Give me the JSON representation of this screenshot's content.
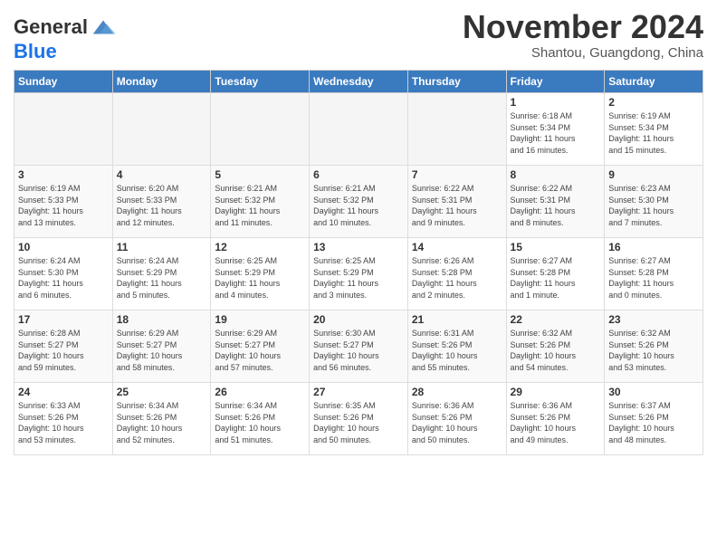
{
  "header": {
    "logo_line1": "General",
    "logo_line2": "Blue",
    "month_title": "November 2024",
    "subtitle": "Shantou, Guangdong, China"
  },
  "weekdays": [
    "Sunday",
    "Monday",
    "Tuesday",
    "Wednesday",
    "Thursday",
    "Friday",
    "Saturday"
  ],
  "weeks": [
    [
      {
        "day": "",
        "info": ""
      },
      {
        "day": "",
        "info": ""
      },
      {
        "day": "",
        "info": ""
      },
      {
        "day": "",
        "info": ""
      },
      {
        "day": "",
        "info": ""
      },
      {
        "day": "1",
        "info": "Sunrise: 6:18 AM\nSunset: 5:34 PM\nDaylight: 11 hours\nand 16 minutes."
      },
      {
        "day": "2",
        "info": "Sunrise: 6:19 AM\nSunset: 5:34 PM\nDaylight: 11 hours\nand 15 minutes."
      }
    ],
    [
      {
        "day": "3",
        "info": "Sunrise: 6:19 AM\nSunset: 5:33 PM\nDaylight: 11 hours\nand 13 minutes."
      },
      {
        "day": "4",
        "info": "Sunrise: 6:20 AM\nSunset: 5:33 PM\nDaylight: 11 hours\nand 12 minutes."
      },
      {
        "day": "5",
        "info": "Sunrise: 6:21 AM\nSunset: 5:32 PM\nDaylight: 11 hours\nand 11 minutes."
      },
      {
        "day": "6",
        "info": "Sunrise: 6:21 AM\nSunset: 5:32 PM\nDaylight: 11 hours\nand 10 minutes."
      },
      {
        "day": "7",
        "info": "Sunrise: 6:22 AM\nSunset: 5:31 PM\nDaylight: 11 hours\nand 9 minutes."
      },
      {
        "day": "8",
        "info": "Sunrise: 6:22 AM\nSunset: 5:31 PM\nDaylight: 11 hours\nand 8 minutes."
      },
      {
        "day": "9",
        "info": "Sunrise: 6:23 AM\nSunset: 5:30 PM\nDaylight: 11 hours\nand 7 minutes."
      }
    ],
    [
      {
        "day": "10",
        "info": "Sunrise: 6:24 AM\nSunset: 5:30 PM\nDaylight: 11 hours\nand 6 minutes."
      },
      {
        "day": "11",
        "info": "Sunrise: 6:24 AM\nSunset: 5:29 PM\nDaylight: 11 hours\nand 5 minutes."
      },
      {
        "day": "12",
        "info": "Sunrise: 6:25 AM\nSunset: 5:29 PM\nDaylight: 11 hours\nand 4 minutes."
      },
      {
        "day": "13",
        "info": "Sunrise: 6:25 AM\nSunset: 5:29 PM\nDaylight: 11 hours\nand 3 minutes."
      },
      {
        "day": "14",
        "info": "Sunrise: 6:26 AM\nSunset: 5:28 PM\nDaylight: 11 hours\nand 2 minutes."
      },
      {
        "day": "15",
        "info": "Sunrise: 6:27 AM\nSunset: 5:28 PM\nDaylight: 11 hours\nand 1 minute."
      },
      {
        "day": "16",
        "info": "Sunrise: 6:27 AM\nSunset: 5:28 PM\nDaylight: 11 hours\nand 0 minutes."
      }
    ],
    [
      {
        "day": "17",
        "info": "Sunrise: 6:28 AM\nSunset: 5:27 PM\nDaylight: 10 hours\nand 59 minutes."
      },
      {
        "day": "18",
        "info": "Sunrise: 6:29 AM\nSunset: 5:27 PM\nDaylight: 10 hours\nand 58 minutes."
      },
      {
        "day": "19",
        "info": "Sunrise: 6:29 AM\nSunset: 5:27 PM\nDaylight: 10 hours\nand 57 minutes."
      },
      {
        "day": "20",
        "info": "Sunrise: 6:30 AM\nSunset: 5:27 PM\nDaylight: 10 hours\nand 56 minutes."
      },
      {
        "day": "21",
        "info": "Sunrise: 6:31 AM\nSunset: 5:26 PM\nDaylight: 10 hours\nand 55 minutes."
      },
      {
        "day": "22",
        "info": "Sunrise: 6:32 AM\nSunset: 5:26 PM\nDaylight: 10 hours\nand 54 minutes."
      },
      {
        "day": "23",
        "info": "Sunrise: 6:32 AM\nSunset: 5:26 PM\nDaylight: 10 hours\nand 53 minutes."
      }
    ],
    [
      {
        "day": "24",
        "info": "Sunrise: 6:33 AM\nSunset: 5:26 PM\nDaylight: 10 hours\nand 53 minutes."
      },
      {
        "day": "25",
        "info": "Sunrise: 6:34 AM\nSunset: 5:26 PM\nDaylight: 10 hours\nand 52 minutes."
      },
      {
        "day": "26",
        "info": "Sunrise: 6:34 AM\nSunset: 5:26 PM\nDaylight: 10 hours\nand 51 minutes."
      },
      {
        "day": "27",
        "info": "Sunrise: 6:35 AM\nSunset: 5:26 PM\nDaylight: 10 hours\nand 50 minutes."
      },
      {
        "day": "28",
        "info": "Sunrise: 6:36 AM\nSunset: 5:26 PM\nDaylight: 10 hours\nand 50 minutes."
      },
      {
        "day": "29",
        "info": "Sunrise: 6:36 AM\nSunset: 5:26 PM\nDaylight: 10 hours\nand 49 minutes."
      },
      {
        "day": "30",
        "info": "Sunrise: 6:37 AM\nSunset: 5:26 PM\nDaylight: 10 hours\nand 48 minutes."
      }
    ]
  ]
}
